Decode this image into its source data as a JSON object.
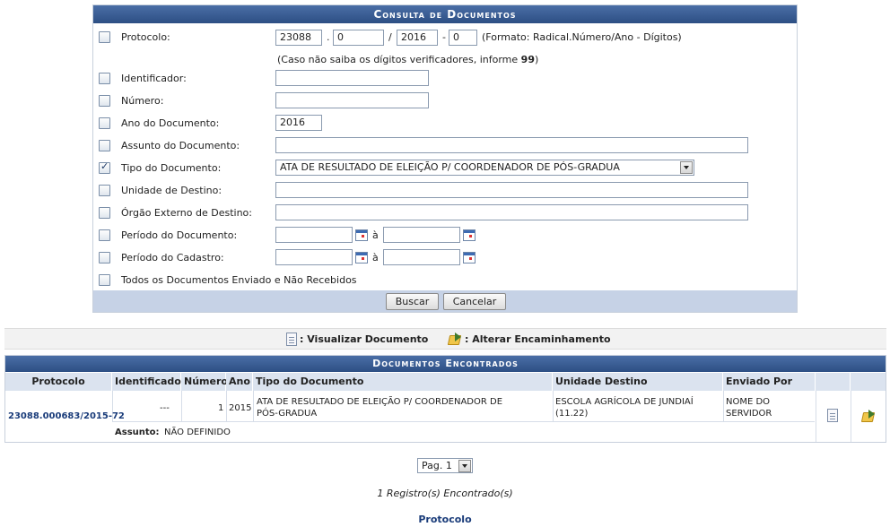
{
  "form": {
    "title": "Consulta de Documentos",
    "protocolo": {
      "label": "Protocolo:",
      "radical": "23088",
      "numero": "0",
      "ano": "2016",
      "digitos": "0",
      "format_hint": "(Formato: Radical.Número/Ano - Dígitos)",
      "dots_hint_prefix": "(Caso não saiba os dígitos verificadores, informe ",
      "dots_hint_value": "99",
      "dots_hint_suffix": ")"
    },
    "identificador": {
      "label": "Identificador:",
      "value": ""
    },
    "numero": {
      "label": "Número:",
      "value": ""
    },
    "ano_documento": {
      "label": "Ano do Documento:",
      "value": "2016"
    },
    "assunto": {
      "label": "Assunto do Documento:",
      "value": ""
    },
    "tipo": {
      "label": "Tipo do Documento:",
      "value": "ATA DE RESULTADO DE ELEIÇÃO P/ COORDENADOR DE PÓS-GRADUA",
      "checked": true
    },
    "unidade_destino": {
      "label": "Unidade de Destino:",
      "value": ""
    },
    "orgao_externo": {
      "label": "Órgão Externo de Destino:",
      "value": ""
    },
    "periodo_documento": {
      "label": "Período do Documento:",
      "sep": "à"
    },
    "periodo_cadastro": {
      "label": "Período do Cadastro:",
      "sep": "à"
    },
    "todos": {
      "label": "Todos os Documentos Enviado e Não Recebidos"
    },
    "buttons": {
      "buscar": "Buscar",
      "cancelar": "Cancelar"
    }
  },
  "legend": {
    "visualizar": ": Visualizar Documento",
    "alterar": ": Alterar Encaminhamento"
  },
  "results": {
    "title": "Documentos Encontrados",
    "columns": [
      "Protocolo",
      "Identificador",
      "Número",
      "Ano",
      "Tipo do Documento",
      "Unidade Destino",
      "Enviado Por"
    ],
    "rows": [
      {
        "protocolo": "23088.000683/2015-72",
        "identificador": "---",
        "numero": "1",
        "ano": "2015",
        "tipo": "ATA DE RESULTADO DE ELEIÇÃO P/ COORDENADOR DE PÓS-GRADUA",
        "unidade": "ESCOLA AGRÍCOLA DE JUNDIAÍ (11.22)",
        "enviado": "NOME DO SERVIDOR",
        "assunto_label": "Assunto:",
        "assunto": "NÃO DEFINIDO"
      }
    ]
  },
  "pager": {
    "value": "Pag. 1"
  },
  "count_text": "1 Registro(s) Encontrado(s)",
  "footer_link": "Protocolo",
  "colors": {
    "caption": "#2d4f84",
    "header_cell": "#dbe3ef",
    "footer_bar": "#c6d2e6",
    "link": "#1a3c7a"
  }
}
